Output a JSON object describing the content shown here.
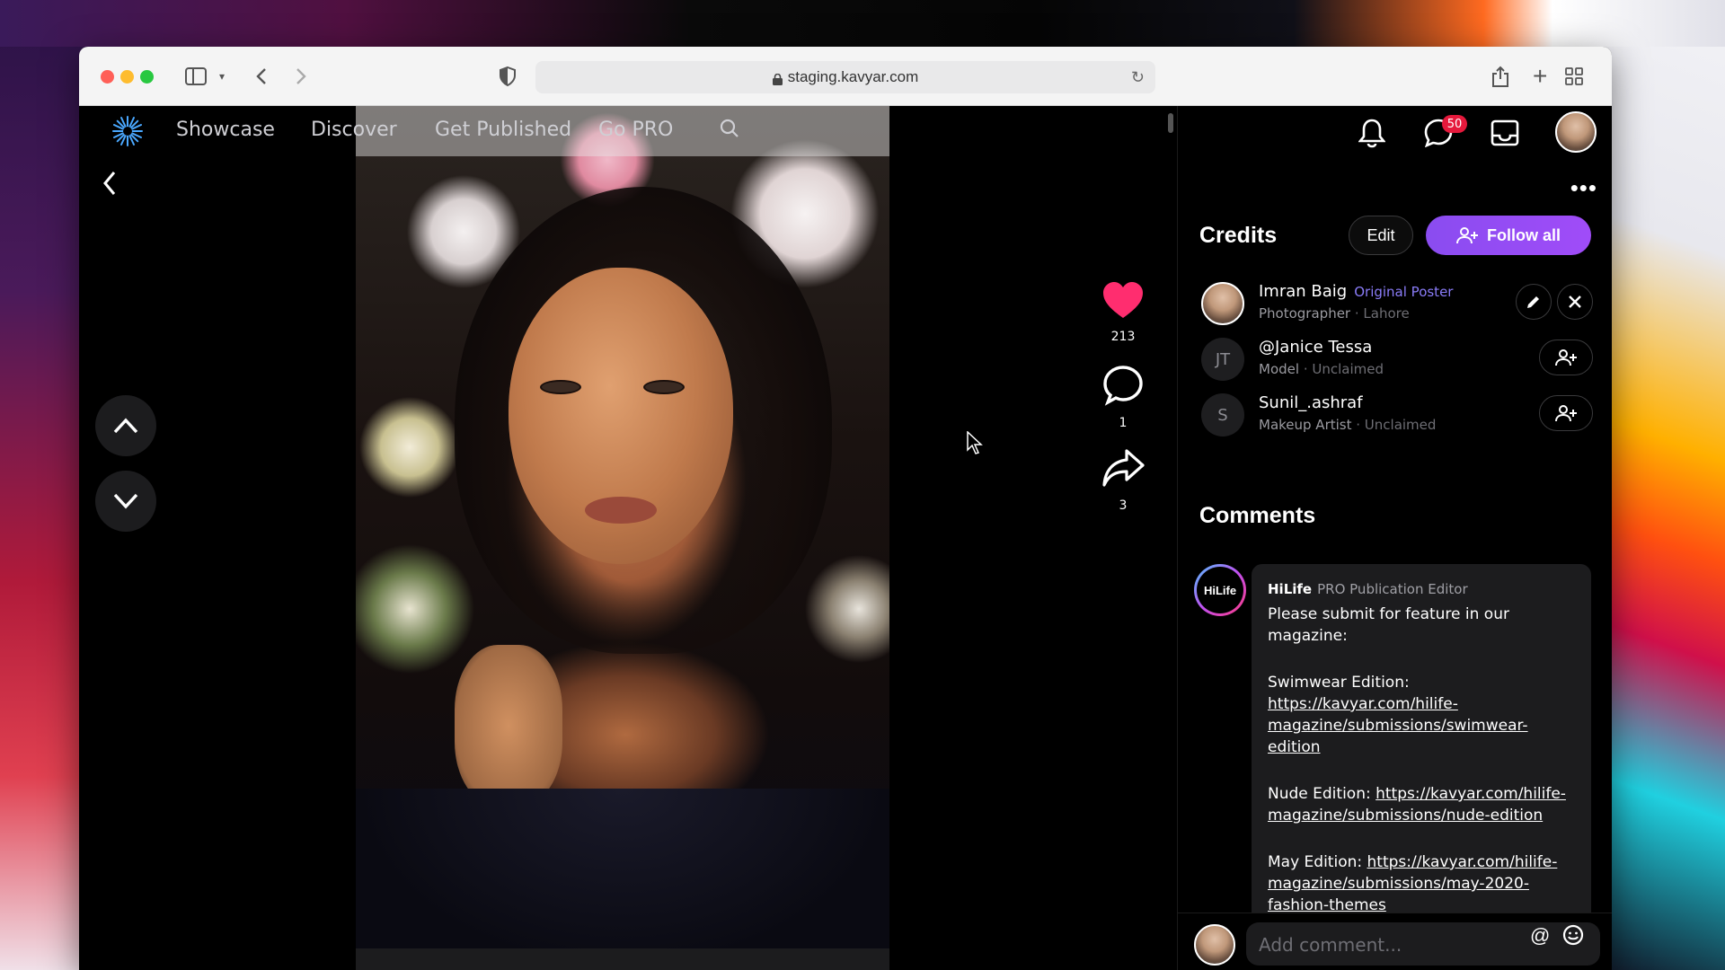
{
  "browser": {
    "url": "staging.kavyar.com"
  },
  "nav": {
    "items": [
      "Showcase",
      "Discover",
      "Get Published",
      "Go PRO"
    ]
  },
  "post": {
    "likes": "213",
    "comments": "1",
    "shares": "3",
    "accent_like": "#ff2d6f"
  },
  "header": {
    "messages_badge": "50"
  },
  "credits": {
    "title": "Credits",
    "edit_label": "Edit",
    "follow_all_label": "Follow all",
    "people": [
      {
        "name": "Imran Baig",
        "tag": "Original Poster",
        "role": "Photographer",
        "location": "Lahore"
      },
      {
        "name": "@Janice Tessa",
        "initials": "JT",
        "role": "Model",
        "status": "Unclaimed"
      },
      {
        "name": "Sunil_.ashraf",
        "initials": "S",
        "role": "Makeup Artist",
        "status": "Unclaimed"
      }
    ]
  },
  "comments": {
    "title": "Comments",
    "items": [
      {
        "avatar_text": "HiLife",
        "author": "HiLife",
        "role": "PRO Publication Editor",
        "intro": "Please submit for feature in our magazine:",
        "swim_label": "Swimwear Edition:",
        "swim_link": "https://kavyar.com/hilife-magazine/submissions/swimwear-edition",
        "nude_label": "Nude Edition:",
        "nude_link": "https://kavyar.com/hilife-magazine/submissions/nude-edition",
        "may_label": "May Edition:",
        "may_link": "https://kavyar.com/hilife-magazine/submissions/may-2020-fashion-themes"
      }
    ],
    "composer_placeholder": "Add comment..."
  }
}
